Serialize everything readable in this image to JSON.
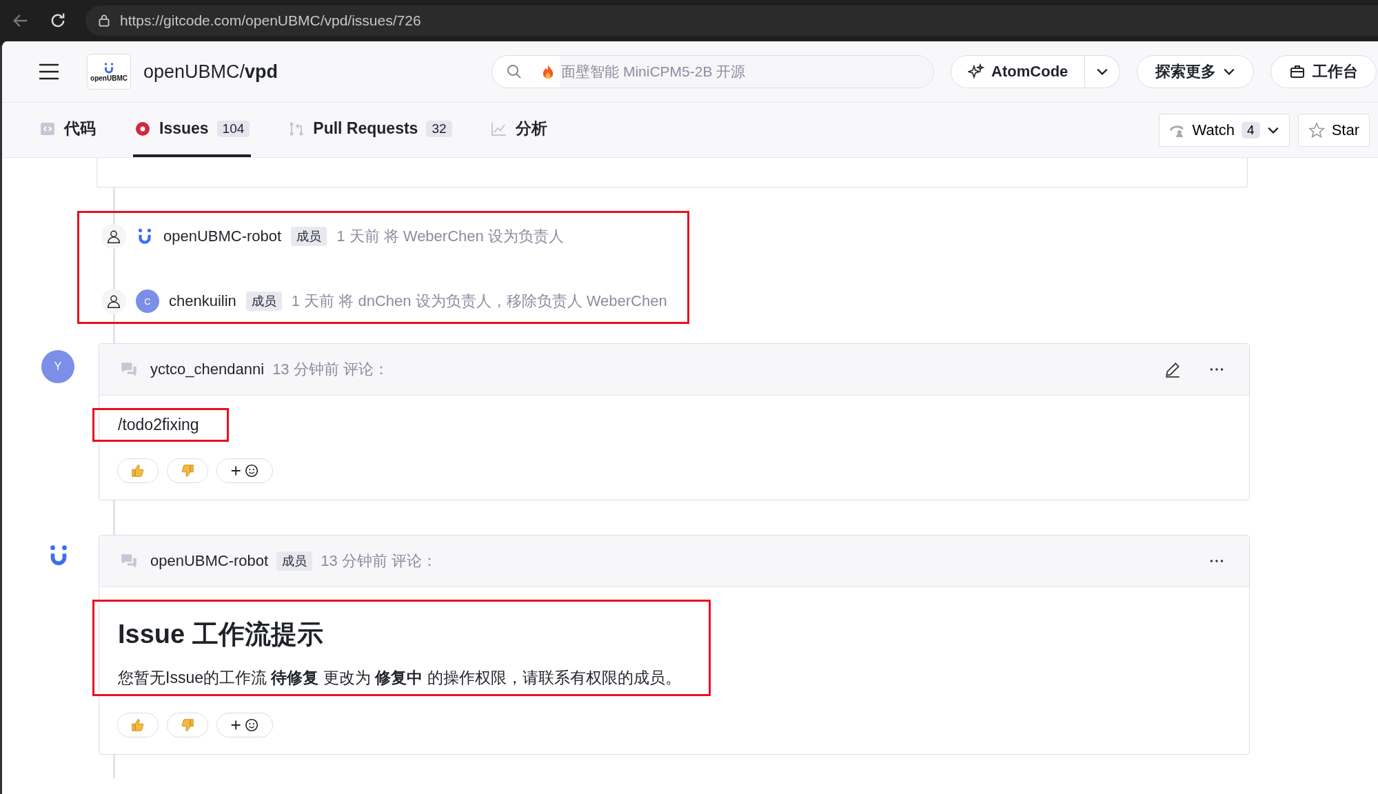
{
  "browser": {
    "url": "https://gitcode.com/openUBMC/vpd/issues/726"
  },
  "header": {
    "repo_owner": "openUBMC/",
    "repo_name": "vpd",
    "logo_caption": "openUBMC",
    "search": {
      "placeholder": "面壁智能 MiniCPM5-2B 开源"
    },
    "buttons": [
      {
        "label": "AtomCode",
        "kind": "atom"
      },
      {
        "label": "探索更多",
        "kind": "explore"
      },
      {
        "label": "工作台",
        "kind": "desk"
      }
    ]
  },
  "tabs": [
    {
      "label": "代码",
      "kind": "code",
      "selected": false
    },
    {
      "label": "Issues",
      "kind": "issues",
      "count": "104",
      "selected": true
    },
    {
      "label": "Pull Requests",
      "kind": "pr",
      "count": "32",
      "selected": false
    },
    {
      "label": "分析",
      "kind": "chart",
      "selected": false
    }
  ],
  "repo_actions": {
    "watch": {
      "label": "Watch",
      "count": "4"
    },
    "star": {
      "label": "Star"
    }
  },
  "events_annotated": true,
  "events": [
    {
      "kind": "logo",
      "user": "openUBMC-robot",
      "role": "成员",
      "text": "1 天前 将 WeberChen 设为负责人"
    },
    {
      "kind": "letter",
      "avatar_letter": "C",
      "user": "chenkuilin",
      "role": "成员",
      "text": "1 天前 将 dnChen 设为负责人，移除负责人 WeberChen"
    }
  ],
  "comments": [
    {
      "kind": "letter",
      "avatar_letter": "Y",
      "user": "yctco_chendanni",
      "time": "13 分钟前 评论：",
      "editable": true,
      "annotated": true,
      "body": [
        {
          "kind": "paragraph",
          "text": "/todo2fixing"
        }
      ]
    },
    {
      "kind": "logo",
      "user": "openUBMC-robot",
      "role": "成员",
      "time": "13 分钟前 评论：",
      "annotated": true,
      "body": [
        {
          "kind": "heading",
          "text": "Issue 工作流提示"
        },
        {
          "kind": "paragraph",
          "text": "您暂无Issue的工作流 **待修复** 更改为 **修复中** 的操作权限，请联系有权限的成员。"
        }
      ]
    }
  ]
}
